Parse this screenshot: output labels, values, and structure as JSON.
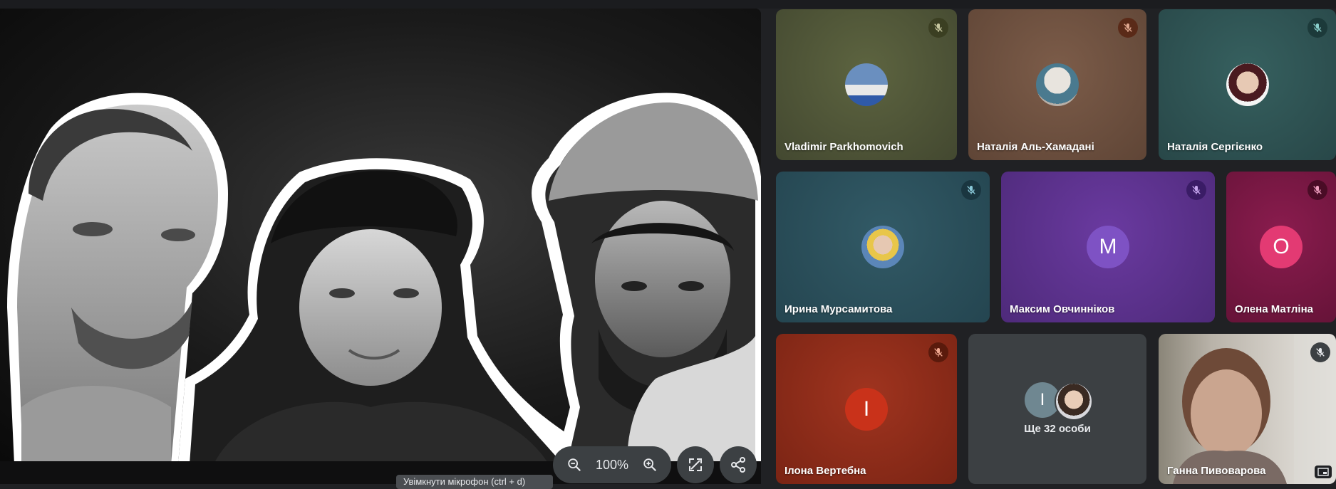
{
  "presentation": {
    "zoom_level": "100%",
    "tooltip": "Увімкнути мікрофон (ctrl + d)"
  },
  "participants": [
    {
      "name": "Vladimir Parkhomovich",
      "avatar": "photo",
      "muted": true,
      "bg": "#4f5535"
    },
    {
      "name": "Наталія Аль-Хамадані",
      "avatar": "photo",
      "muted": true,
      "bg": "#6e5140"
    },
    {
      "name": "Наталія Сергієнко",
      "avatar": "photo",
      "muted": true,
      "bg": "#2f5356"
    },
    {
      "name": "Ирина Мурсамитова",
      "avatar": "photo",
      "muted": true,
      "bg": "#2b4d58"
    },
    {
      "name": "Максим Овчинніков",
      "avatar": "M",
      "muted": true,
      "bg": "#5a2c8c",
      "avatar_color": "#7b4ac0"
    },
    {
      "name": "Олена Матліна",
      "avatar": "O",
      "muted": true,
      "bg": "#7a1a45",
      "avatar_color": "#e0356e"
    },
    {
      "name": "Ілона Вертебна",
      "avatar": "I",
      "muted": true,
      "bg": "#8c2d1e",
      "avatar_color": "#c8341c"
    },
    {
      "name": "Ганна Пивоварова",
      "avatar": "video",
      "muted": true,
      "bg": "#b5b0a8"
    }
  ],
  "more_people": {
    "label": "Ще 32 особи",
    "avatar_letter": "I"
  },
  "colors": {
    "page_bg": "#202124",
    "control_bg": "#3c4043"
  }
}
